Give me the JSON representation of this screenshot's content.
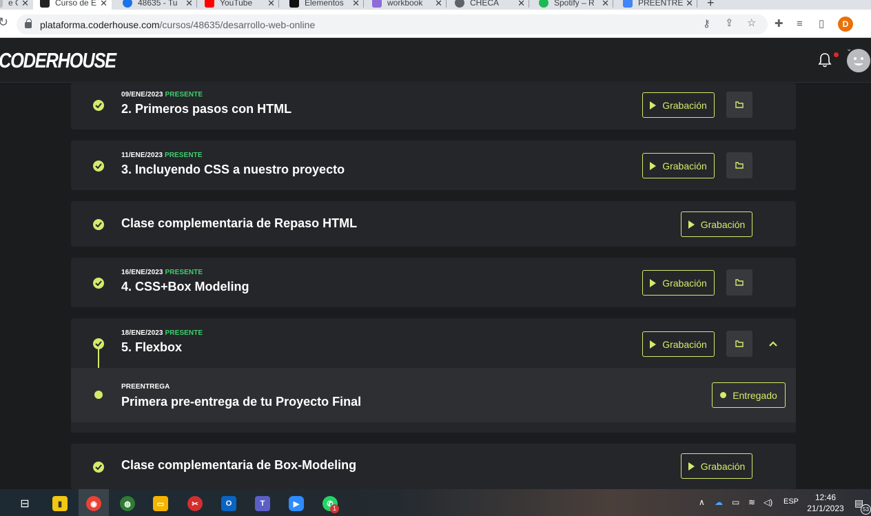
{
  "browser": {
    "tabs": [
      {
        "title": "e C",
        "favicon": "#bdbdbd"
      },
      {
        "title": "Curso de E",
        "favicon": "#222222"
      },
      {
        "title": "48635 - Tu",
        "favicon": "#1a73e8"
      },
      {
        "title": "YouTube",
        "favicon": "#ff0000"
      },
      {
        "title": "Elementos",
        "favicon": "#111111"
      },
      {
        "title": "workbook",
        "favicon": "#8e6bd8"
      },
      {
        "title": "CHECA",
        "favicon": "#5f6368"
      },
      {
        "title": "Spotify – R",
        "favicon": "#1db954"
      },
      {
        "title": "PREENTRE",
        "favicon": "#4285f4"
      }
    ],
    "new_tab": "+",
    "url_host": "plataforma.coderhouse.com",
    "url_path": "/cursos/48635/desarrollo-web-online",
    "profile_initial": "D"
  },
  "app": {
    "logo": "CODERHOUSE"
  },
  "classes": [
    {
      "date": "09/ENE/2023",
      "status": "PRESENTE",
      "title": "2. Primeros pasos con HTML",
      "recording": "Grabación"
    },
    {
      "date": "11/ENE/2023",
      "status": "PRESENTE",
      "title": "3. Incluyendo CSS a nuestro proyecto",
      "recording": "Grabación"
    },
    {
      "date": "",
      "status": "",
      "title": "Clase complementaria de Repaso HTML",
      "recording": "Grabación"
    },
    {
      "date": "16/ENE/2023",
      "status": "PRESENTE",
      "title": "4. CSS+Box Modeling",
      "recording": "Grabación"
    },
    {
      "date": "18/ENE/2023",
      "status": "PRESENTE",
      "title": "5. Flexbox",
      "recording": "Grabación",
      "sub": {
        "label": "PREENTREGA",
        "title": "Primera pre-entrega de tu Proyecto Final",
        "button": "Entregado"
      }
    },
    {
      "date": "",
      "status": "",
      "title": "Clase complementaria de Box-Modeling",
      "recording": "Grabación"
    }
  ],
  "taskbar": {
    "whatsapp_badge": "1",
    "language": "ESP",
    "time": "12:46",
    "date": "21/1/2023",
    "notification_count": "53"
  }
}
